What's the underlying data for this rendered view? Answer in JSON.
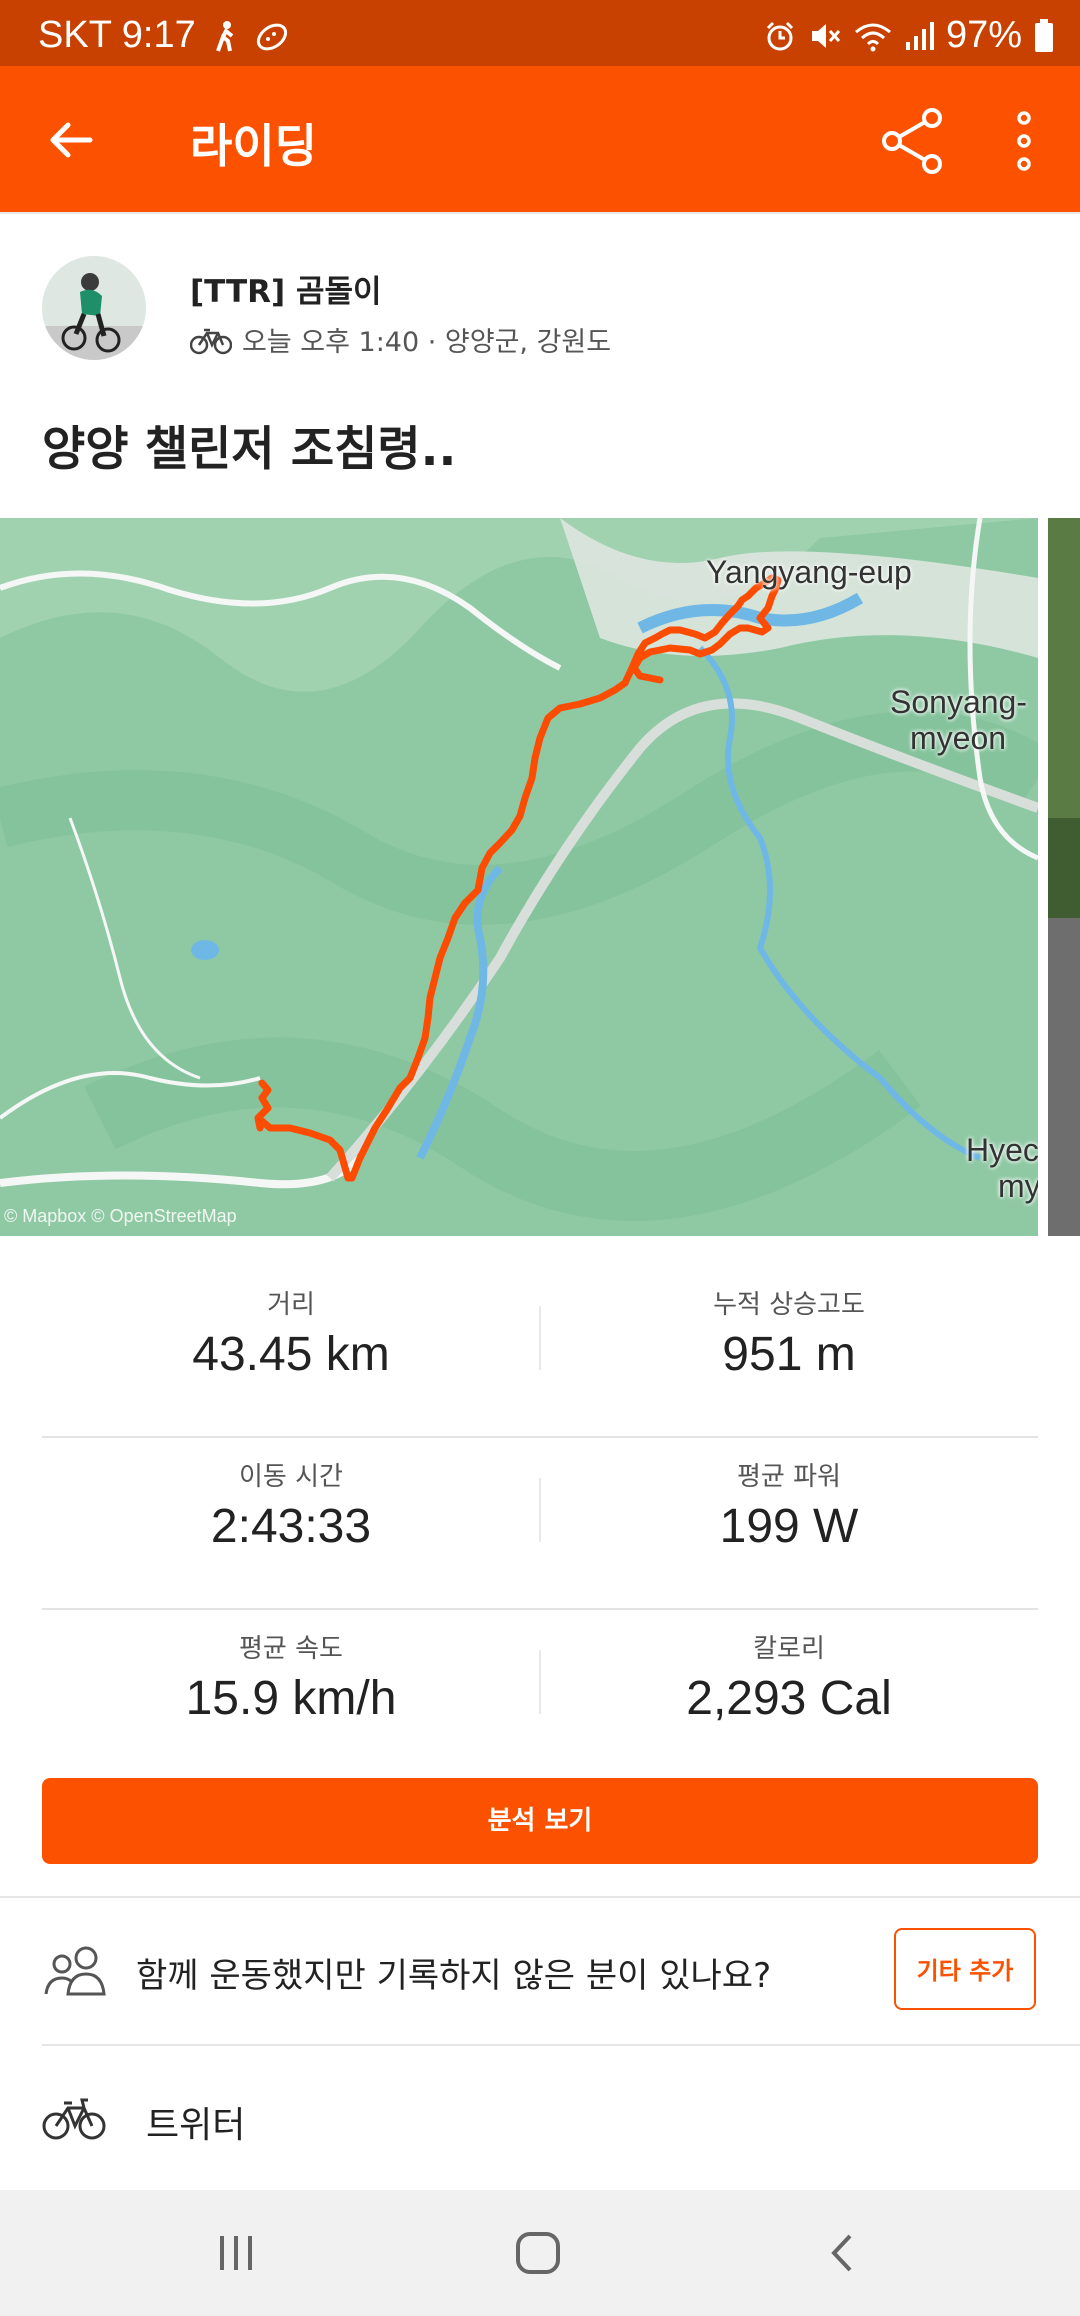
{
  "status_bar": {
    "carrier_time": "SKT 9:17",
    "battery": "97%"
  },
  "app_bar": {
    "title": "라이딩"
  },
  "activity": {
    "athlete": "[TTR] 곰돌이",
    "meta": "오늘 오후 1:40 · 양양군, 강원도",
    "title": "양양 챌린저 조침령.."
  },
  "map": {
    "labels": {
      "town1": "Yangyang-eup",
      "town2_line1": "Sonyang-",
      "town2_line2": "myeon",
      "town3_line1": "Hyec",
      "town3_line2": "my"
    },
    "attribution": "© Mapbox © OpenStreetMap",
    "route_color": "#fc4c02"
  },
  "stats": [
    {
      "label": "거리",
      "value": "43.45 km"
    },
    {
      "label": "누적 상승고도",
      "value": "951 m"
    },
    {
      "label": "이동 시간",
      "value": "2:43:33"
    },
    {
      "label": "평균 파워",
      "value": "199 W"
    },
    {
      "label": "평균 속도",
      "value": "15.9 km/h"
    },
    {
      "label": "칼로리",
      "value": "2,293 Cal"
    }
  ],
  "analysis_button": "분석 보기",
  "prompt": {
    "text": "함께 운동했지만 기록하지 않은 분이 있나요?",
    "button": "기타 추가"
  },
  "gear": {
    "name": "트위터"
  },
  "colors": {
    "brand": "#fc5200",
    "status_bar": "#c94100"
  }
}
